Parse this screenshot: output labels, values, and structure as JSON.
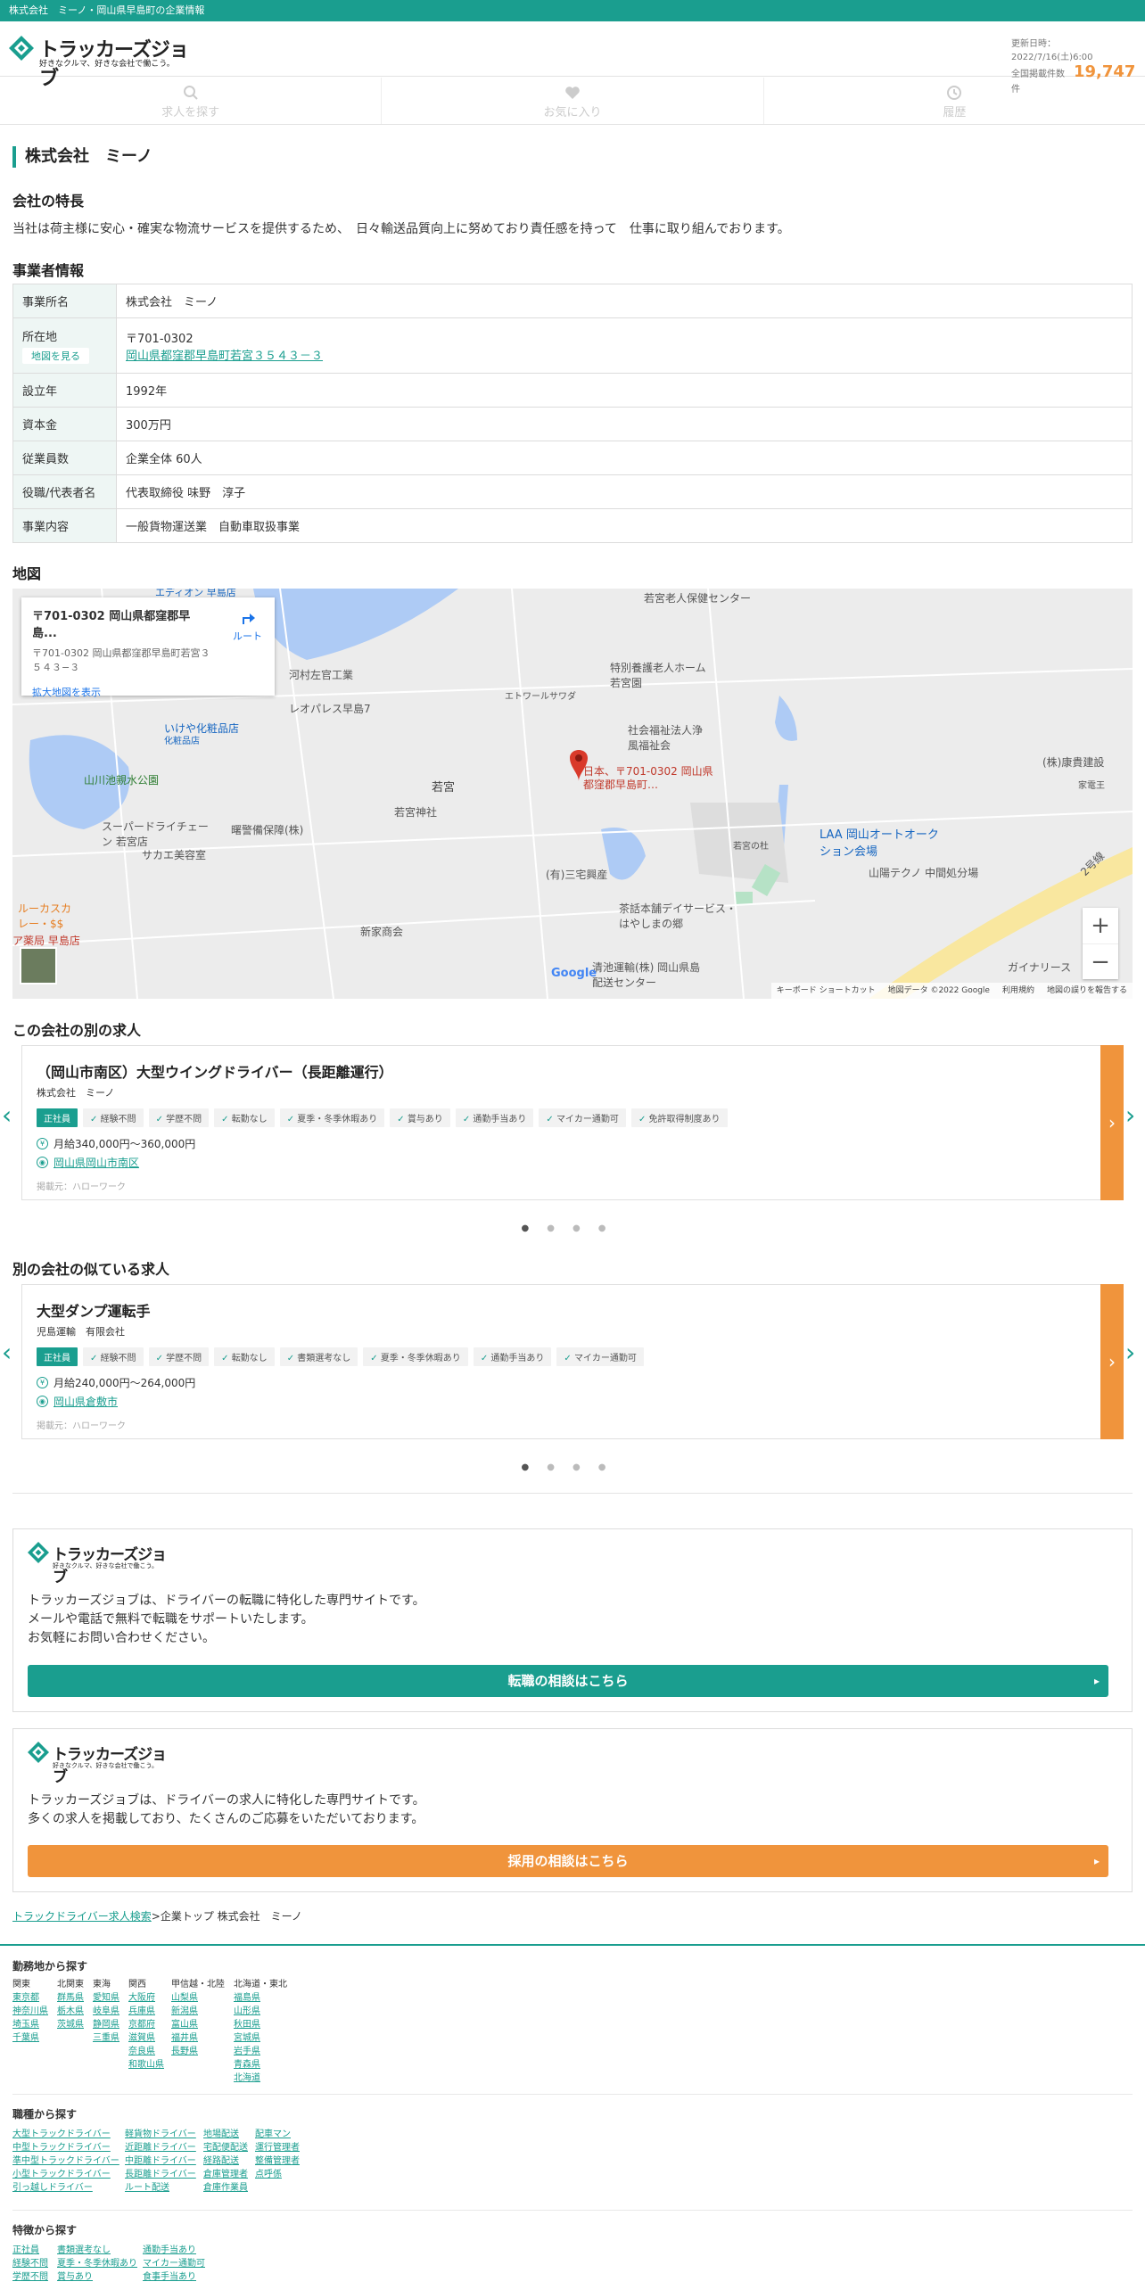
{
  "topbar": {
    "text": "株式会社　ミーノ・岡山県早島町の企業情報"
  },
  "header": {
    "logo_text": "トラッカーズジョブ",
    "logo_sub": "好きなクルマ、好きな会社で働こう。",
    "update_label": "更新日時：2022/7/16(土)6:00",
    "count_label": "全国掲載件数",
    "count": "19,747",
    "count_unit": "件"
  },
  "nav": [
    {
      "label": "求人を探す",
      "icon": "search-icon"
    },
    {
      "label": "お気に入り",
      "icon": "heart-icon"
    },
    {
      "label": "履歴",
      "icon": "history-icon"
    }
  ],
  "company": {
    "title": "株式会社　ミーノ",
    "feature_heading": "会社の特長",
    "feature_text": "当社は荷主様に安心・確実な物流サービスを提供するため、　日々輸送品質向上に努めており責任感を持って　仕事に取り組んでおります。",
    "info_heading": "事業者情報",
    "rows": [
      {
        "label": "事業所名",
        "value": "株式会社　ミーノ"
      },
      {
        "label": "所在地",
        "button": "地図を見る",
        "zip": "〒701-0302",
        "address": "岡山県都窪郡早島町若宮３５４３－３"
      },
      {
        "label": "設立年",
        "value": "1992年"
      },
      {
        "label": "資本金",
        "value": "300万円"
      },
      {
        "label": "従業員数",
        "value": "企業全体 60人"
      },
      {
        "label": "役職/代表者名",
        "value": "代表取締役 味野　淳子"
      },
      {
        "label": "事業内容",
        "value": "一般貨物運送業　自動車取扱事業"
      }
    ]
  },
  "map": {
    "heading": "地図",
    "card_title": "〒701-0302 岡山県都窪郡早島...",
    "card_addr": "〒701-0302 岡山県都窪郡早島町若宮３５４３−３",
    "route": "ルート",
    "enlarge": "拡大地図を表示",
    "pin_label": "日本、〒701-0302 岡山県都窪郡早島町…",
    "labels": [
      "若宮老人保健センター",
      "河村左官工業",
      "レオパレス早島7",
      "いけや化粧品店",
      "化粧品店",
      "山川池親水公園",
      "特別養護老人ホーム 若宮園",
      "エトワールサワダ",
      "社会福祉法人浄風福祉会",
      "若宮",
      "若宮神社",
      "曙警備保障(株)",
      "スーパードライチェーン 若宮店",
      "サカエ美容室",
      "(有)三宅興産",
      "若宮の杜",
      "LAA 岡山オートオークション会場",
      "山陽テクノ 中間処分場",
      "(株)康貴建設",
      "家電王",
      "茶話本舗デイサービス・はやしまの郷",
      "新家商会",
      "ルーカスカレー・$$",
      "ア薬局 早島店",
      "ガイナリース",
      "2号線",
      "清池運輸(株) 岡山県島配送センター",
      "エディオン 早島店"
    ],
    "footer": [
      "キーボード ショートカット",
      "地図データ ©2022 Google",
      "利用規約",
      "地図の誤りを報告する"
    ],
    "google": "Google",
    "zoom_in": "+",
    "zoom_out": "−"
  },
  "other_jobs": {
    "heading": "この会社の別の求人",
    "title": "（岡山市南区）大型ウイングドライバー（長距離運行）",
    "company": "株式会社　ミーノ",
    "tags": [
      "正社員",
      "経験不問",
      "学歴不問",
      "転勤なし",
      "夏季・冬季休暇あり",
      "賞与あり",
      "通勤手当あり",
      "マイカー通勤可",
      "免許取得制度あり"
    ],
    "salary": "月給340,000円〜360,000円",
    "location": "岡山県岡山市南区",
    "source": "掲載元：ハローワーク"
  },
  "similar_jobs": {
    "heading": "別の会社の似ている求人",
    "title": "大型ダンプ運転手",
    "company": "児島運輸　有限会社",
    "tags": [
      "正社員",
      "経験不問",
      "学歴不問",
      "転勤なし",
      "書類選考なし",
      "夏季・冬季休暇あり",
      "通勤手当あり",
      "マイカー通勤可"
    ],
    "salary": "月給240,000円〜264,000円",
    "location": "岡山県倉敷市",
    "source": "掲載元：ハローワーク"
  },
  "promo1": {
    "text1": "トラッカーズジョブは、ドライバーの転職に特化した専門サイトです。",
    "text2": "メールや電話で無料で転職をサポートいたします。",
    "text3": "お気軽にお問い合わせください。",
    "button": "転職の相談はこちら"
  },
  "promo2": {
    "text1": "トラッカーズジョブは、ドライバーの求人に特化した専門サイトです。",
    "text2": "多くの求人を掲載しており、たくさんのご応募をいただいております。",
    "button": "採用の相談はこちら"
  },
  "breadcrumb": {
    "link": "トラックドライバー求人検索",
    "sep": ">企業トップ 株式会社　ミーノ"
  },
  "footer": {
    "area_heading": "勤務地から探す",
    "areas": [
      {
        "name": "関東",
        "items": [
          "東京都",
          "神奈川県",
          "埼玉県",
          "千葉県"
        ]
      },
      {
        "name": "北関東",
        "items": [
          "群馬県",
          "栃木県",
          "茨城県"
        ]
      },
      {
        "name": "東海",
        "items": [
          "愛知県",
          "岐阜県",
          "静岡県",
          "三重県"
        ]
      },
      {
        "name": "関西",
        "items": [
          "大阪府",
          "兵庫県",
          "京都府",
          "滋賀県",
          "奈良県",
          "和歌山県"
        ]
      },
      {
        "name": "甲信越・北陸",
        "items": [
          "山梨県",
          "新潟県",
          "富山県",
          "福井県",
          "長野県"
        ]
      },
      {
        "name": "北海道・東北",
        "items": [
          "福島県",
          "山形県",
          "秋田県",
          "宮城県",
          "岩手県",
          "青森県",
          "北海道"
        ]
      }
    ],
    "job_heading": "職種から探す",
    "jobs": [
      [
        "大型トラックドライバー",
        "中型トラックドライバー",
        "準中型トラックドライバー",
        "小型トラックドライバー",
        "引っ越しドライバー"
      ],
      [
        "軽貨物ドライバー",
        "近距離ドライバー",
        "中距離ドライバー",
        "長距離ドライバー",
        "ルート配送"
      ],
      [
        "地場配送",
        "宅配便配送",
        "経路配送",
        "倉庫管理者",
        "倉庫作業員"
      ],
      [
        "配車マン",
        "運行管理者",
        "整備管理者",
        "点呼係"
      ]
    ],
    "feature_heading": "特徴から探す",
    "features": [
      [
        "正社員",
        "経験不問",
        "学歴不問"
      ],
      [
        "書類選考なし",
        "夏季・冬季休暇あり",
        "賞与あり"
      ],
      [
        "通勤手当あり",
        "マイカー通勤可",
        "食事手当あり"
      ]
    ]
  }
}
